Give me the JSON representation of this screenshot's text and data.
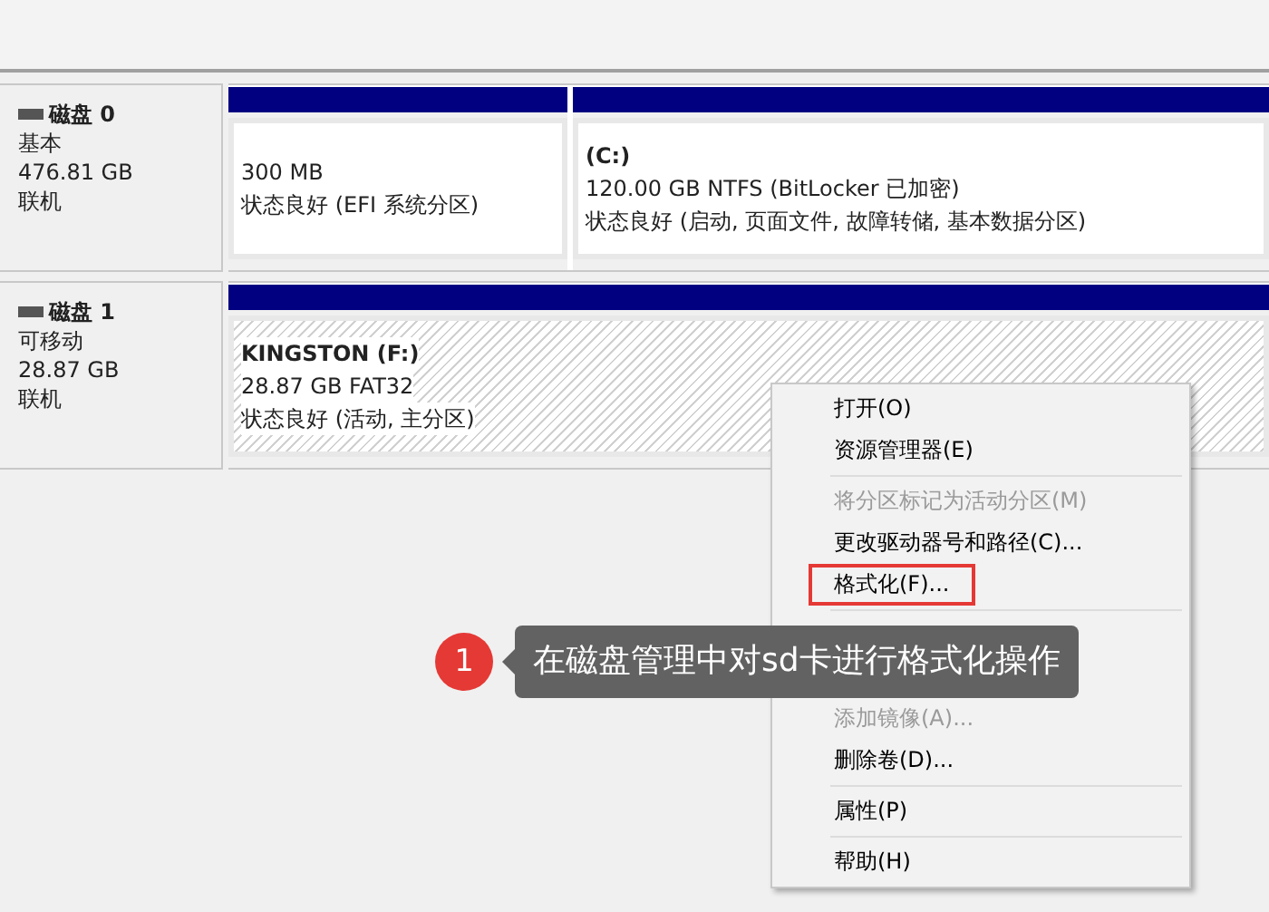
{
  "disks": [
    {
      "name": "磁盘 0",
      "type": "基本",
      "size": "476.81 GB",
      "status": "联机",
      "partitions": [
        {
          "size": "300 MB",
          "state": "状态良好 (EFI 系统分区)",
          "hatched": false
        },
        {
          "label": "(C:)",
          "size": "120.00 GB NTFS (BitLocker 已加密)",
          "state": "状态良好 (启动, 页面文件, 故障转储, 基本数据分区)",
          "hatched": false
        }
      ]
    },
    {
      "name": "磁盘 1",
      "type": "可移动",
      "size": "28.87 GB",
      "status": "联机",
      "partitions": [
        {
          "label": "KINGSTON  (F:)",
          "size": "28.87 GB FAT32",
          "state": "状态良好 (活动, 主分区)",
          "hatched": true
        }
      ]
    }
  ],
  "context_menu": [
    {
      "kind": "item",
      "label": "打开(O)",
      "disabled": false,
      "highlighted": false
    },
    {
      "kind": "item",
      "label": "资源管理器(E)",
      "disabled": false,
      "highlighted": false
    },
    {
      "kind": "separator"
    },
    {
      "kind": "item",
      "label": "将分区标记为活动分区(M)",
      "disabled": true,
      "highlighted": false
    },
    {
      "kind": "item",
      "label": "更改驱动器号和路径(C)...",
      "disabled": false,
      "highlighted": false
    },
    {
      "kind": "item",
      "label": "格式化(F)...",
      "disabled": false,
      "highlighted": true
    },
    {
      "kind": "separator"
    },
    {
      "kind": "covered"
    },
    {
      "kind": "item",
      "label": "添加镜像(A)...",
      "disabled": true,
      "highlighted": false
    },
    {
      "kind": "item",
      "label": "删除卷(D)...",
      "disabled": false,
      "highlighted": false
    },
    {
      "kind": "separator"
    },
    {
      "kind": "item",
      "label": "属性(P)",
      "disabled": false,
      "highlighted": false
    },
    {
      "kind": "separator"
    },
    {
      "kind": "item",
      "label": "帮助(H)",
      "disabled": false,
      "highlighted": false
    }
  ],
  "callout": {
    "number": "1",
    "text": "在磁盘管理中对sd卡进行格式化操作"
  }
}
